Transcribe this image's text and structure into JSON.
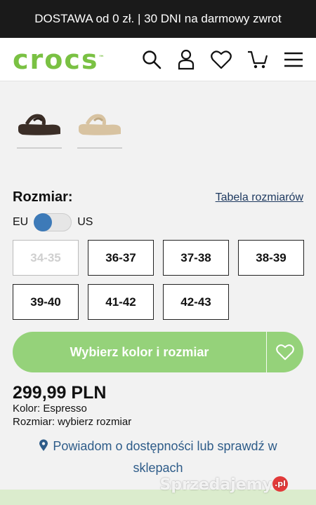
{
  "promo": {
    "text": "DOSTAWA od 0 zł. | 30 DNI na darmowy zwrot"
  },
  "header": {
    "logo_text": "crocs",
    "icons": [
      "search-icon",
      "account-icon",
      "wishlist-heart-icon",
      "cart-icon",
      "menu-icon"
    ]
  },
  "swatches": [
    {
      "name": "Espresso",
      "color": "#3b2e27"
    },
    {
      "name": "beige",
      "color": "#d8c3a1"
    }
  ],
  "size": {
    "title": "Rozmiar:",
    "chart_link": "Tabela rozmiarów",
    "unit_left": "EU",
    "unit_right": "US",
    "options": [
      {
        "label": "34-35",
        "available": false
      },
      {
        "label": "36-37",
        "available": true
      },
      {
        "label": "37-38",
        "available": true
      },
      {
        "label": "38-39",
        "available": true
      },
      {
        "label": "39-40",
        "available": true
      },
      {
        "label": "41-42",
        "available": true
      },
      {
        "label": "42-43",
        "available": true
      }
    ]
  },
  "cta": {
    "label": "Wybierz kolor i rozmiar",
    "color": "#95d27a"
  },
  "product": {
    "price": "299,99 PLN",
    "color_line": "Kolor: Espresso",
    "size_line": "Rozmiar: wybierz rozmiar"
  },
  "notify": {
    "line1": "Powiadom o dostępności lub sprawdź w",
    "line2": "sklepach"
  },
  "watermark": {
    "text": "Sprzedajemy",
    "badge": ".pl"
  }
}
